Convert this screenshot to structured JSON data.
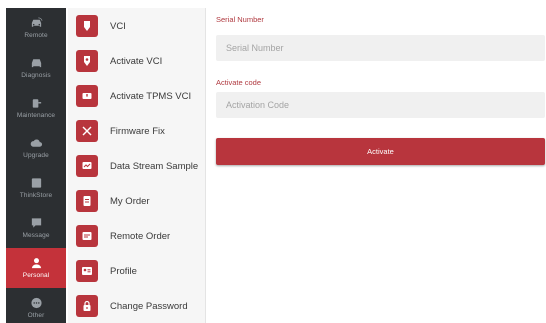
{
  "rail": {
    "items": [
      {
        "label": "Remote",
        "icon": "car-remote-icon",
        "active": false
      },
      {
        "label": "Diagnosis",
        "icon": "car-diagnosis-icon",
        "active": false
      },
      {
        "label": "Maintenance",
        "icon": "wrench-maintenance-icon",
        "active": false
      },
      {
        "label": "Upgrade",
        "icon": "cloud-upgrade-icon",
        "active": false
      },
      {
        "label": "ThinkStore",
        "icon": "store-icon",
        "active": false
      },
      {
        "label": "Message",
        "icon": "message-icon",
        "active": false
      },
      {
        "label": "Personal",
        "icon": "person-icon",
        "active": true
      },
      {
        "label": "Other",
        "icon": "more-icon",
        "active": false
      }
    ]
  },
  "menu": {
    "items": [
      {
        "label": "VCI",
        "icon": "vci-icon"
      },
      {
        "label": "Activate VCI",
        "icon": "activate-vci-icon"
      },
      {
        "label": "Activate TPMS VCI",
        "icon": "tpms-icon"
      },
      {
        "label": "Firmware Fix",
        "icon": "tools-icon"
      },
      {
        "label": "Data Stream Sample",
        "icon": "data-stream-icon"
      },
      {
        "label": "My Order",
        "icon": "order-icon"
      },
      {
        "label": "Remote Order",
        "icon": "remote-order-icon"
      },
      {
        "label": "Profile",
        "icon": "profile-card-icon"
      },
      {
        "label": "Change Password",
        "icon": "lock-icon"
      }
    ]
  },
  "form": {
    "serial_label": "Serial Number",
    "serial_placeholder": "Serial Number",
    "code_label": "Activate code",
    "code_placeholder": "Activation Code",
    "activate_button": "Activate"
  },
  "colors": {
    "accent": "#b8353d",
    "rail_bg": "#2c2f32",
    "menu_bg": "#f6f6f6"
  }
}
